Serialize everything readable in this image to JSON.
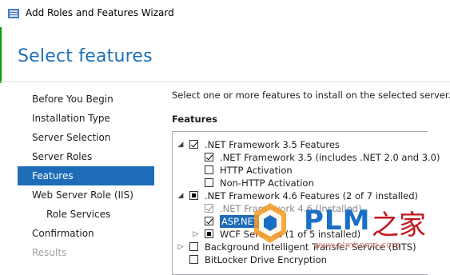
{
  "window": {
    "title": "Add Roles and Features Wizard",
    "icon": "server-manager-icon"
  },
  "page_title": "Select features",
  "nav": {
    "items": [
      {
        "label": "Before You Begin",
        "state": "normal",
        "sub": false
      },
      {
        "label": "Installation Type",
        "state": "normal",
        "sub": false
      },
      {
        "label": "Server Selection",
        "state": "normal",
        "sub": false
      },
      {
        "label": "Server Roles",
        "state": "normal",
        "sub": false
      },
      {
        "label": "Features",
        "state": "active",
        "sub": false
      },
      {
        "label": "Web Server Role (IIS)",
        "state": "normal",
        "sub": false
      },
      {
        "label": "Role Services",
        "state": "normal",
        "sub": true
      },
      {
        "label": "Confirmation",
        "state": "normal",
        "sub": false
      },
      {
        "label": "Results",
        "state": "disabled",
        "sub": false
      }
    ]
  },
  "main": {
    "intro": "Select one or more features to install on the selected server.",
    "features_label": "Features",
    "tree": [
      {
        "label": ".NET Framework 3.5 Features",
        "level": 0,
        "expander": "expanded",
        "check": "checked",
        "style": "normal"
      },
      {
        "label": ".NET Framework 3.5 (includes .NET 2.0 and 3.0)",
        "level": 1,
        "expander": "none",
        "check": "checked",
        "style": "normal"
      },
      {
        "label": "HTTP Activation",
        "level": 1,
        "expander": "none",
        "check": "unchecked",
        "style": "normal"
      },
      {
        "label": "Non-HTTP Activation",
        "level": 1,
        "expander": "none",
        "check": "unchecked",
        "style": "normal"
      },
      {
        "label": ".NET Framework 4.6 Features (2 of 7 installed)",
        "level": 0,
        "expander": "expanded",
        "check": "partial",
        "style": "normal"
      },
      {
        "label": ".NET Framework 4.6 (Installed)",
        "level": 1,
        "expander": "none",
        "check": "checked-disabled",
        "style": "dim"
      },
      {
        "label": "ASP.NET 4.6",
        "level": 1,
        "expander": "none",
        "check": "checked",
        "style": "selected"
      },
      {
        "label": "WCF Services (1 of 5 installed)",
        "level": 1,
        "expander": "collapsed",
        "check": "partial",
        "style": "normal"
      },
      {
        "label": "Background Intelligent Transfer Service (BITS)",
        "level": 0,
        "expander": "collapsed",
        "check": "unchecked",
        "style": "normal"
      },
      {
        "label": "BitLocker Drive Encryption",
        "level": 0,
        "expander": "none",
        "check": "unchecked",
        "style": "normal"
      }
    ]
  },
  "watermark": {
    "brand": "PLM",
    "brand_cn": "之家",
    "url": "www.plmhome.com"
  },
  "colors": {
    "accent": "#1e6cb8",
    "title_blue": "#1f6fb5",
    "accent_green": "#00a300"
  }
}
